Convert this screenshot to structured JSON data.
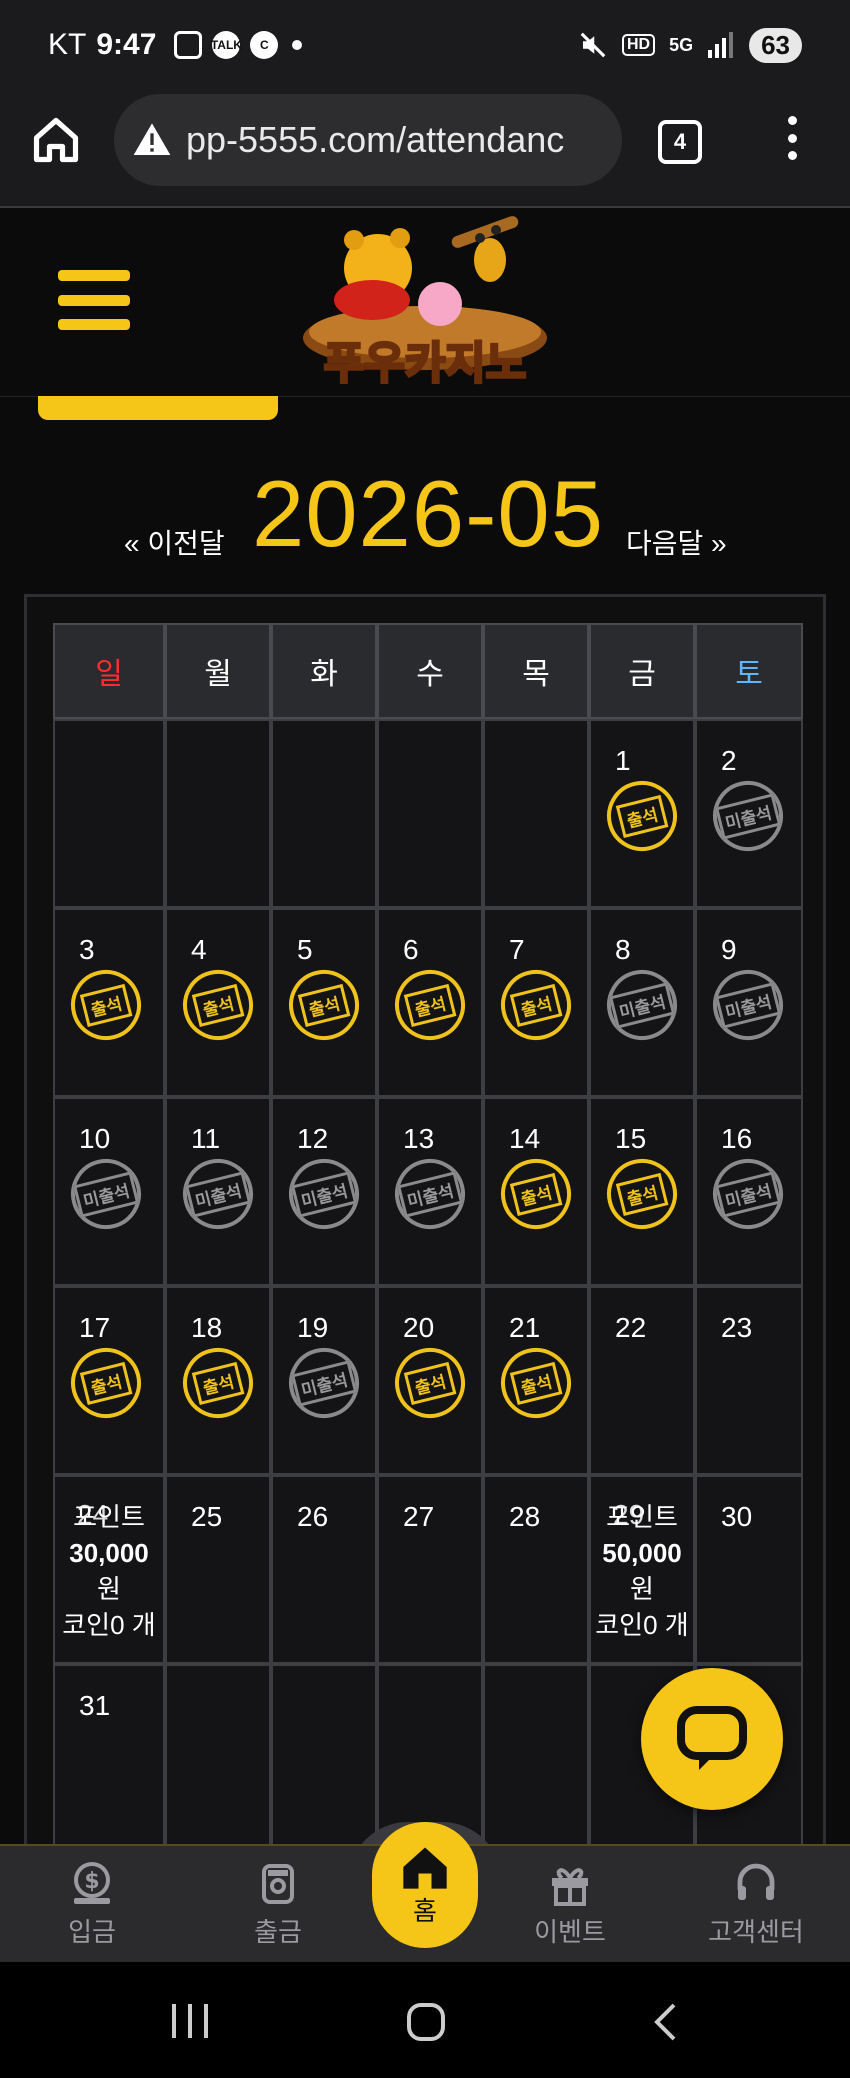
{
  "status_bar": {
    "carrier": "KT",
    "time": "9:47",
    "notif_icons": [
      "screenshot-icon",
      "talk-icon",
      "c-icon"
    ],
    "battery": "63",
    "network": "5G"
  },
  "browser": {
    "url": "pp-5555.com/attendanc",
    "tab_count": "4"
  },
  "site": {
    "logo_text": "푸우카지노"
  },
  "calendar": {
    "prev_label": "« 이전달",
    "month": "2026-05",
    "next_label": "다음달 »",
    "weekdays": [
      "일",
      "월",
      "화",
      "수",
      "목",
      "금",
      "토"
    ],
    "stamp_attended": "출석",
    "stamp_absent": "미출석",
    "weeks": [
      [
        {
          "day": "",
          "stamp": ""
        },
        {
          "day": "",
          "stamp": ""
        },
        {
          "day": "",
          "stamp": ""
        },
        {
          "day": "",
          "stamp": ""
        },
        {
          "day": "",
          "stamp": ""
        },
        {
          "day": "1",
          "stamp": "attended"
        },
        {
          "day": "2",
          "stamp": "absent"
        }
      ],
      [
        {
          "day": "3",
          "stamp": "attended"
        },
        {
          "day": "4",
          "stamp": "attended"
        },
        {
          "day": "5",
          "stamp": "attended"
        },
        {
          "day": "6",
          "stamp": "attended"
        },
        {
          "day": "7",
          "stamp": "attended"
        },
        {
          "day": "8",
          "stamp": "absent"
        },
        {
          "day": "9",
          "stamp": "absent"
        }
      ],
      [
        {
          "day": "10",
          "stamp": "absent"
        },
        {
          "day": "11",
          "stamp": "absent"
        },
        {
          "day": "12",
          "stamp": "absent"
        },
        {
          "day": "13",
          "stamp": "absent"
        },
        {
          "day": "14",
          "stamp": "attended"
        },
        {
          "day": "15",
          "stamp": "attended"
        },
        {
          "day": "16",
          "stamp": "absent"
        }
      ],
      [
        {
          "day": "17",
          "stamp": "attended"
        },
        {
          "day": "18",
          "stamp": "attended"
        },
        {
          "day": "19",
          "stamp": "absent"
        },
        {
          "day": "20",
          "stamp": "attended"
        },
        {
          "day": "21",
          "stamp": "attended"
        },
        {
          "day": "22",
          "stamp": ""
        },
        {
          "day": "23",
          "stamp": ""
        }
      ],
      [
        {
          "day": "24",
          "stamp": "",
          "reward": [
            "포인트",
            "30,000",
            "원",
            "코인0 개"
          ]
        },
        {
          "day": "25",
          "stamp": ""
        },
        {
          "day": "26",
          "stamp": ""
        },
        {
          "day": "27",
          "stamp": ""
        },
        {
          "day": "28",
          "stamp": ""
        },
        {
          "day": "29",
          "stamp": "",
          "reward": [
            "포인트",
            "50,000",
            "원",
            "코인0 개"
          ]
        },
        {
          "day": "30",
          "stamp": ""
        }
      ],
      [
        {
          "day": "31",
          "stamp": ""
        },
        {
          "day": "",
          "stamp": ""
        },
        {
          "day": "",
          "stamp": ""
        },
        {
          "day": "",
          "stamp": ""
        },
        {
          "day": "",
          "stamp": ""
        },
        {
          "day": "",
          "stamp": ""
        },
        {
          "day": "",
          "stamp": ""
        }
      ]
    ]
  },
  "bottom_nav": {
    "items": [
      {
        "label": "입금",
        "icon": "deposit-icon"
      },
      {
        "label": "출금",
        "icon": "withdraw-icon"
      },
      {
        "label": "홈",
        "icon": "home-icon"
      },
      {
        "label": "이벤트",
        "icon": "gift-icon"
      },
      {
        "label": "고객센터",
        "icon": "headset-icon"
      }
    ]
  },
  "colors": {
    "accent": "#f5c518",
    "sunday": "#ff2d2d",
    "saturday": "#5fb6ff",
    "background": "#0b0b0c"
  }
}
